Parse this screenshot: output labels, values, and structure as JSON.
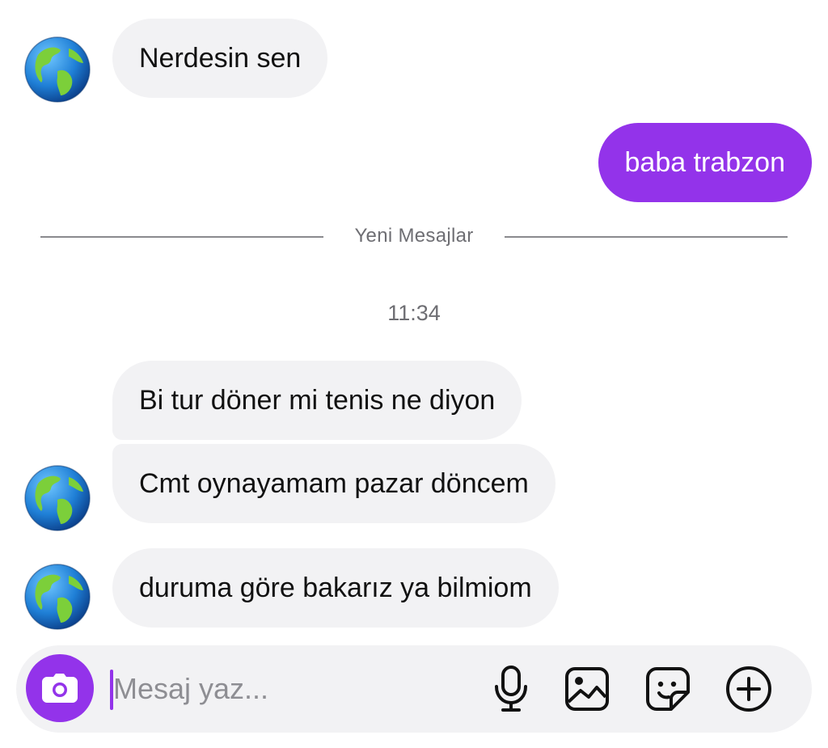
{
  "divider": {
    "label": "Yeni Mesajlar"
  },
  "timestamp": "11:34",
  "messages": [
    {
      "direction": "incoming",
      "text": "Nerdesin sen",
      "avatar": "earth-globe-americas"
    },
    {
      "direction": "outgoing",
      "text": "baba trabzon"
    },
    {
      "direction": "incoming",
      "text": "Bi tur döner mi tenis ne diyon"
    },
    {
      "direction": "incoming",
      "text": "Cmt oynayamam pazar döncem",
      "avatar": "earth-globe-americas"
    },
    {
      "direction": "incoming",
      "text": "duruma göre bakarız ya bilmiom",
      "avatar": "earth-globe-americas"
    }
  ],
  "composer": {
    "placeholder": "Mesaj yaz...",
    "value": "",
    "icons": [
      "camera-icon",
      "microphone-icon",
      "image-icon",
      "sticker-icon",
      "add-circle-icon"
    ]
  },
  "colors": {
    "accent": "#9333ea",
    "bubble_incoming": "#f2f2f4",
    "text_secondary": "#6e6e73"
  }
}
